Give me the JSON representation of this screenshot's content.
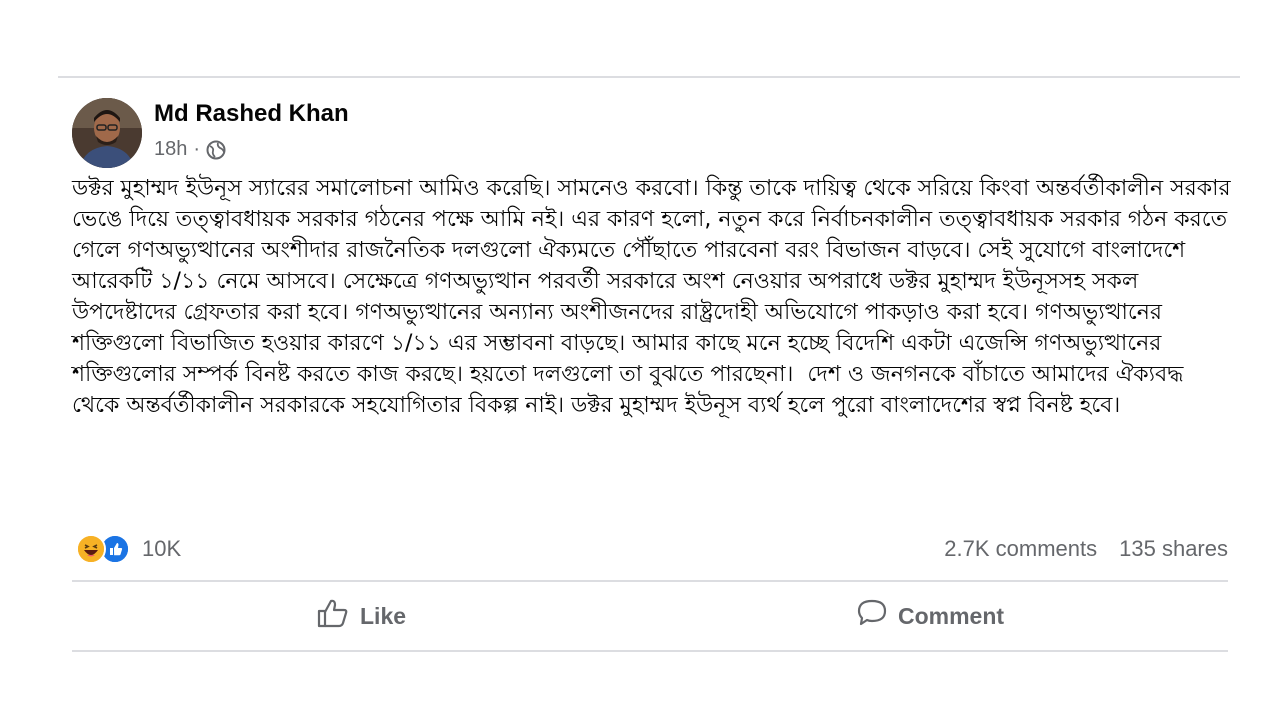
{
  "post": {
    "author": "Md Rashed Khan",
    "time": "18h",
    "separator": "·",
    "privacy_icon": "globe-icon",
    "body": "ডক্টর মুহাম্মদ ইউনূস স্যারের সমালোচনা আমিও করেছি। সামনেও করবো। কিন্তু তাকে দায়িত্ব থেকে সরিয়ে কিংবা অন্তর্বর্তীকালীন সরকার ভেঙে দিয়ে তত্ত্বাবধায়ক সরকার গঠনের পক্ষে আমি নই। এর কারণ হলো, নতুন করে নির্বাচনকালীন তত্ত্বাবধায়ক সরকার গঠন করতে গেলে গণঅভ্যুত্থানের অংশীদার রাজনৈতিক দলগুলো ঐক্যমতে পৌঁছাতে পারবেনা বরং বিভাজন বাড়বে। সেই সুযোগে বাংলাদেশে আরেকটি ১/১১ নেমে আসবে। সেক্ষেত্রে গণঅভ্যুত্থান পরবর্তী সরকারে অংশ নেওয়ার অপরাধে ডক্টর মুহাম্মদ ইউনূসসহ সকল উপদেষ্টাদের গ্রেফতার করা হবে। গণঅভ্যুত্থানের অন্যান্য অংশীজনদের রাষ্ট্রদোহী অভিযোগে পাকড়াও করা হবে। গণঅভ্যুত্থানের শক্তিগুলো বিভাজিত হওয়ার কারণে ১/১১ এর সম্ভাবনা বাড়ছে। আমার কাছে মনে হচ্ছে বিদেশি একটা এজেন্সি গণঅভ্যুত্থানের শক্তিগুলোর সম্পর্ক বিনষ্ট করতে কাজ করছে। হয়তো দলগুলো তা বুঝতে পারছেনা।  দেশ ও জনগনকে বাঁচাতে আমাদের ঐক্যবদ্ধ থেকে অন্তর্বর্তীকালীন সরকারকে সহযোগিতার বিকল্প নাই। ডক্টর মুহাম্মদ ইউনূস ব্যর্থ হলে পুরো বাংলাদেশের স্বপ্ন বিনষ্ট হবে।"
  },
  "stats": {
    "reactions": [
      "haha-reaction-icon",
      "like-reaction-icon"
    ],
    "reaction_count": "10K",
    "comments": "2.7K comments",
    "shares": "135 shares"
  },
  "actions": {
    "like_label": "Like",
    "like_icon": "thumbs-up-icon",
    "comment_label": "Comment",
    "comment_icon": "speech-bubble-icon"
  },
  "colors": {
    "text_primary": "#050505",
    "text_secondary": "#65676b",
    "divider": "#dcdde1",
    "like_blue": "#1b74e4",
    "haha_yellow": "#f7b125"
  }
}
